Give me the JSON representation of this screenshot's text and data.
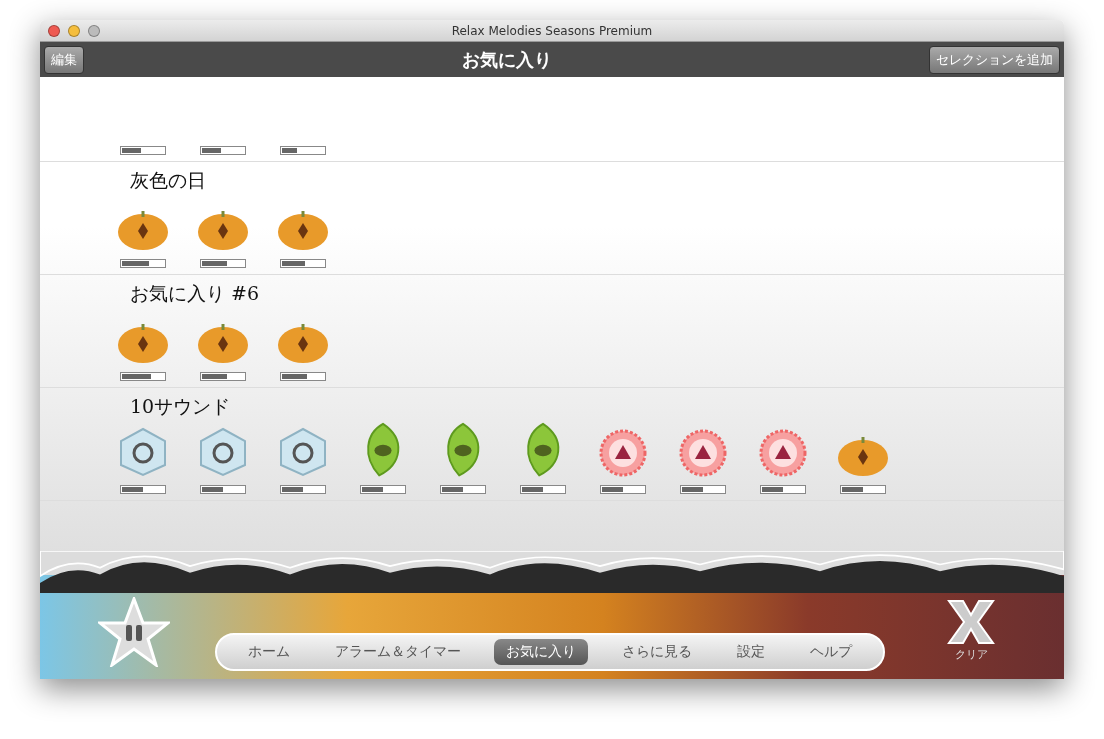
{
  "window": {
    "title": "Relax Melodies Seasons Premium"
  },
  "toolbar": {
    "edit_button": "編集",
    "title": "お気に入り",
    "add_button": "セレクションを追加"
  },
  "groups": [
    {
      "sounds": [
        {
          "level": 0.45
        },
        {
          "level": 0.45
        },
        {
          "level": 0.35
        }
      ]
    },
    {
      "title": "灰色の日",
      "sounds": [
        {
          "kind": "pumpkin",
          "level": 0.65
        },
        {
          "kind": "pumpkin",
          "level": 0.6
        },
        {
          "kind": "pumpkin",
          "level": 0.55
        }
      ]
    },
    {
      "title": "お気に入り #6",
      "sounds": [
        {
          "kind": "pumpkin",
          "level": 0.7
        },
        {
          "kind": "pumpkin",
          "level": 0.6
        },
        {
          "kind": "pumpkin",
          "level": 0.6
        }
      ]
    },
    {
      "title": "10サウンド",
      "sounds": [
        {
          "kind": "ice",
          "level": 0.5
        },
        {
          "kind": "ice",
          "level": 0.5
        },
        {
          "kind": "ice",
          "level": 0.5
        },
        {
          "kind": "leaf",
          "level": 0.5
        },
        {
          "kind": "leaf",
          "level": 0.5
        },
        {
          "kind": "leaf",
          "level": 0.5
        },
        {
          "kind": "flower",
          "level": 0.5
        },
        {
          "kind": "flower",
          "level": 0.5
        },
        {
          "kind": "flower",
          "level": 0.5
        },
        {
          "kind": "pumpkin",
          "level": 0.5
        }
      ]
    }
  ],
  "tabs": [
    {
      "label": "ホーム",
      "selected": false
    },
    {
      "label": "アラーム＆タイマー",
      "selected": false
    },
    {
      "label": "お気に入り",
      "selected": true
    },
    {
      "label": "さらに見る",
      "selected": false
    },
    {
      "label": "設定",
      "selected": false
    },
    {
      "label": "ヘルプ",
      "selected": false
    }
  ],
  "clear_label": "クリア"
}
